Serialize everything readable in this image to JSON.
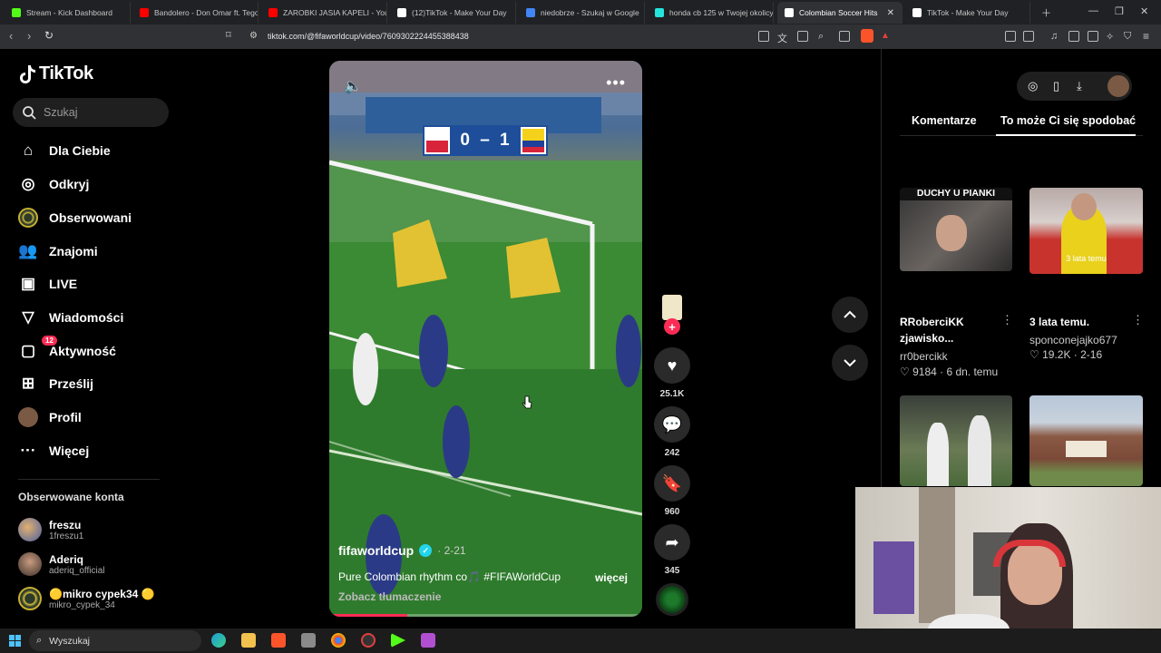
{
  "browser": {
    "tabs": [
      {
        "label": "Stream - Kick Dashboard",
        "color": "#53fc18"
      },
      {
        "label": "Bandolero - Don Omar ft. Tego",
        "color": "#ff0000"
      },
      {
        "label": "ZAROBKI JASIA KAPELI - YouTu",
        "color": "#ff0000"
      },
      {
        "label": "(12)TikTok - Make Your Day",
        "color": "#ffffff"
      },
      {
        "label": "niedobrze - Szukaj w Google",
        "color": "#4285f4"
      },
      {
        "label": "honda cb 125 w Twojej okolicy",
        "color": "#23e5db"
      },
      {
        "label": "Colombian Soccer Hits",
        "color": "#ffffff"
      },
      {
        "label": "TikTok - Make Your Day",
        "color": "#ffffff"
      }
    ],
    "url": "tiktok.com/@fifaworldcup/video/7609302224455388438"
  },
  "tiktok": {
    "logo": "TikTok",
    "search_placeholder": "Szukaj",
    "nav": [
      {
        "label": "Dla Ciebie",
        "icon": "home-icon"
      },
      {
        "label": "Odkryj",
        "icon": "compass-icon"
      },
      {
        "label": "Obserwowani",
        "icon": "following-avatar"
      },
      {
        "label": "Znajomi",
        "icon": "friends-icon"
      },
      {
        "label": "LIVE",
        "icon": "live-icon"
      },
      {
        "label": "Wiadomości",
        "icon": "messages-icon"
      },
      {
        "label": "Aktywność",
        "icon": "inbox-icon",
        "badge": "12"
      },
      {
        "label": "Prześlij",
        "icon": "upload-icon"
      },
      {
        "label": "Profil",
        "icon": "profile-avatar"
      },
      {
        "label": "Więcej",
        "icon": "more-icon"
      }
    ],
    "followed_title": "Obserwowane konta",
    "followed_accounts": [
      {
        "name": "freszu",
        "handle": "1freszu1"
      },
      {
        "name": "Aderiq",
        "handle": "aderiq_official"
      },
      {
        "name": "🟡mikro cypek34 🟡",
        "handle": "mikro_cypek_34"
      }
    ]
  },
  "video": {
    "score_text": "0 – 1",
    "author": "fifaworldcup",
    "date": "· 2-21",
    "caption": "Pure Colombian rhythm co🎵  #FIFAWorldCup",
    "more_label": "więcej",
    "translate_label": "Zobacz tłumaczenie",
    "progress": 0.25,
    "actions": {
      "likes": "25.1K",
      "comments": "242",
      "saves": "960",
      "shares": "345"
    }
  },
  "right_panel": {
    "tabs": [
      "Komentarze",
      "To może Ci się spodobać"
    ],
    "cards": [
      {
        "overlay": "DUCHY U PIANKI",
        "title": "RRoberciKK\nzjawisko...",
        "user": "rr0bercikk",
        "stats": "♡ 9184  ·  6 dn. temu"
      },
      {
        "overlay": "3 lata temu",
        "title": "3 lata temu.",
        "user": "sponconejajko677",
        "stats": "♡ 19.2K  ·  2-16"
      }
    ]
  },
  "taskbar": {
    "search_label": "Wyszukaj"
  }
}
